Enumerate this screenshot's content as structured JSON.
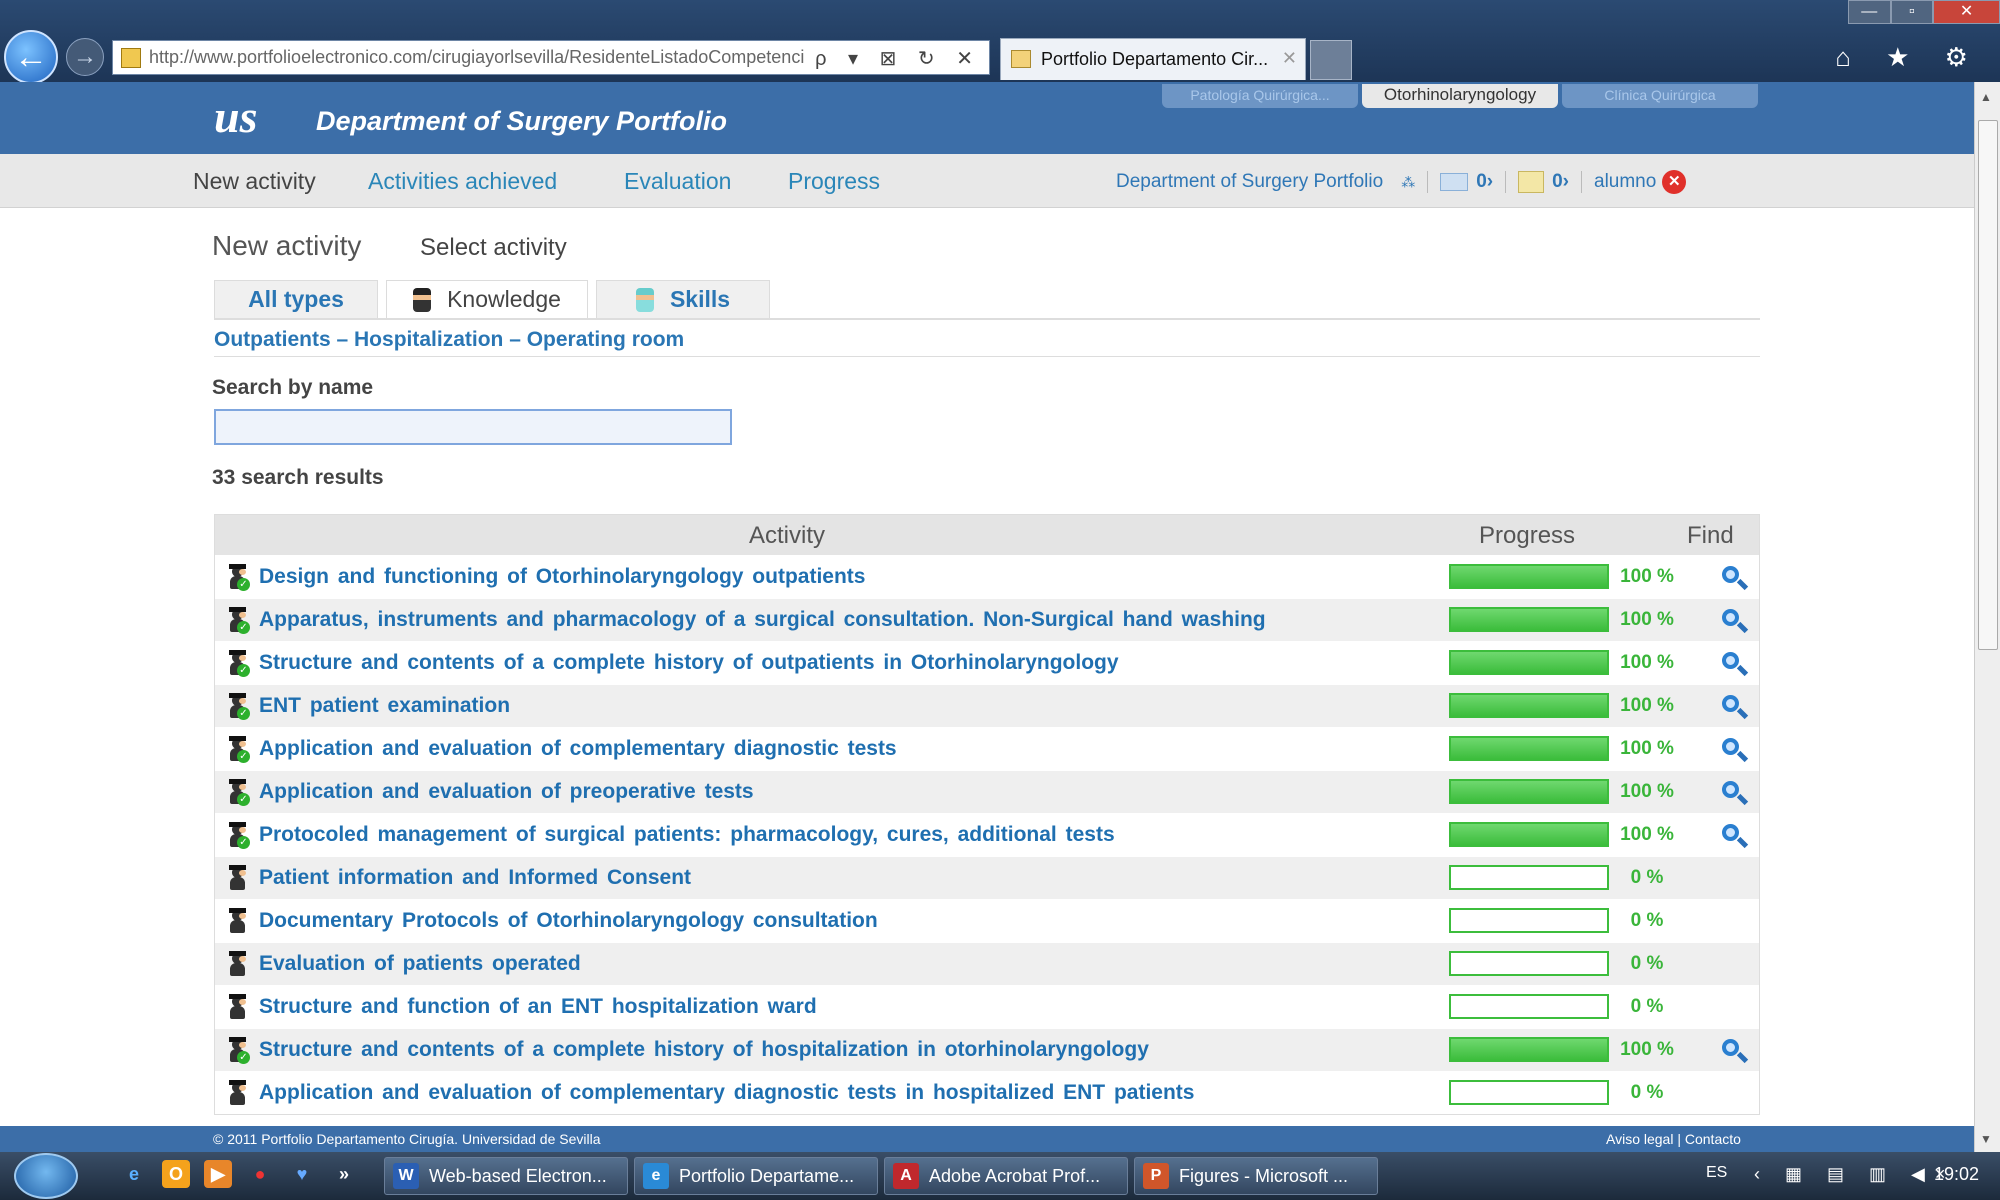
{
  "browser": {
    "url": "http://www.portfolioelectronico.com/cirugiayorlsevilla/ResidenteListadoCompetenci",
    "tab_title": "Portfolio Departamento Cir...",
    "controls": "ρ ▾ ⊠ ↻ ✕",
    "tab_close": "✕",
    "win_min": "—",
    "win_max": "▫",
    "win_close": "✕",
    "right_icons": "⌂ ★ ⚙"
  },
  "header": {
    "logo_text": "us",
    "title": "Department of Surgery Portfolio",
    "dept_tabs": [
      {
        "label": "Patología Quirúrgica...",
        "active": false
      },
      {
        "label": "Otorhinolaryngology",
        "active": true
      },
      {
        "label": "Clínica Quirúrgica",
        "active": false
      }
    ]
  },
  "nav": {
    "items": [
      "New activity",
      "Activities achieved",
      "Evaluation",
      "Progress"
    ],
    "right_title": "Department of Surgery Portfolio",
    "messages_count": "0›",
    "notifications_count": "0›",
    "user": "alumno"
  },
  "page": {
    "heading": "New activity",
    "subheading": "Select activity",
    "type_tabs": [
      "All types",
      "Knowledge",
      "Skills"
    ],
    "location_links": "Outpatients – Hospitalization – Operating room",
    "search_label": "Search by name",
    "search_value": "",
    "result_count": "33 search results"
  },
  "table": {
    "headers": {
      "activity": "Activity",
      "progress": "Progress",
      "find": "Find"
    },
    "rows": [
      {
        "name": "Design and functioning of Otorhinolaryngology outpatients",
        "progress": 100,
        "progress_text": "100 %",
        "done": true
      },
      {
        "name": "Apparatus, instruments and pharmacology of a surgical consultation. Non-Surgical hand washing",
        "progress": 100,
        "progress_text": "100 %",
        "done": true
      },
      {
        "name": "Structure and contents of a complete history of outpatients in Otorhinolaryngology",
        "progress": 100,
        "progress_text": "100 %",
        "done": true
      },
      {
        "name": "ENT patient examination",
        "progress": 100,
        "progress_text": "100 %",
        "done": true
      },
      {
        "name": "Application and evaluation of complementary diagnostic tests",
        "progress": 100,
        "progress_text": "100 %",
        "done": true
      },
      {
        "name": "Application and evaluation of preoperative tests",
        "progress": 100,
        "progress_text": "100 %",
        "done": true
      },
      {
        "name": "Protocoled management of surgical patients: pharmacology, cures, additional tests",
        "progress": 100,
        "progress_text": "100 %",
        "done": true
      },
      {
        "name": "Patient information and Informed Consent",
        "progress": 0,
        "progress_text": "0 %",
        "done": false
      },
      {
        "name": "Documentary Protocols of Otorhinolaryngology consultation",
        "progress": 0,
        "progress_text": "0 %",
        "done": false
      },
      {
        "name": "Evaluation of patients operated",
        "progress": 0,
        "progress_text": "0 %",
        "done": false
      },
      {
        "name": "Structure and function of an ENT hospitalization ward",
        "progress": 0,
        "progress_text": "0 %",
        "done": false
      },
      {
        "name": "Structure and contents of a complete history of hospitalization in otorhinolaryngology",
        "progress": 100,
        "progress_text": "100 %",
        "done": true
      },
      {
        "name": "Application and evaluation of complementary diagnostic tests in hospitalized ENT patients",
        "progress": 0,
        "progress_text": "0 %",
        "done": false
      }
    ]
  },
  "footer": {
    "copyright": "© 2011 Portfolio Departamento Cirugía. Universidad de Sevilla",
    "links": "Aviso legal  |  Contacto"
  },
  "taskbar": {
    "quick_launch_more": "»",
    "tasks": [
      {
        "label": "Web-based Electron...",
        "icon": "W",
        "color": "#2b5fb3"
      },
      {
        "label": "Portfolio Departame...",
        "icon": "e",
        "color": "#2a8ad6"
      },
      {
        "label": "Adobe Acrobat Prof...",
        "icon": "A",
        "color": "#c0282d"
      },
      {
        "label": "Figures - Microsoft ...",
        "icon": "P",
        "color": "#d0562a"
      }
    ],
    "lang": "ES",
    "tray": "‹ ▦ ▤ ▥ ◀×",
    "clock": "19:02"
  }
}
